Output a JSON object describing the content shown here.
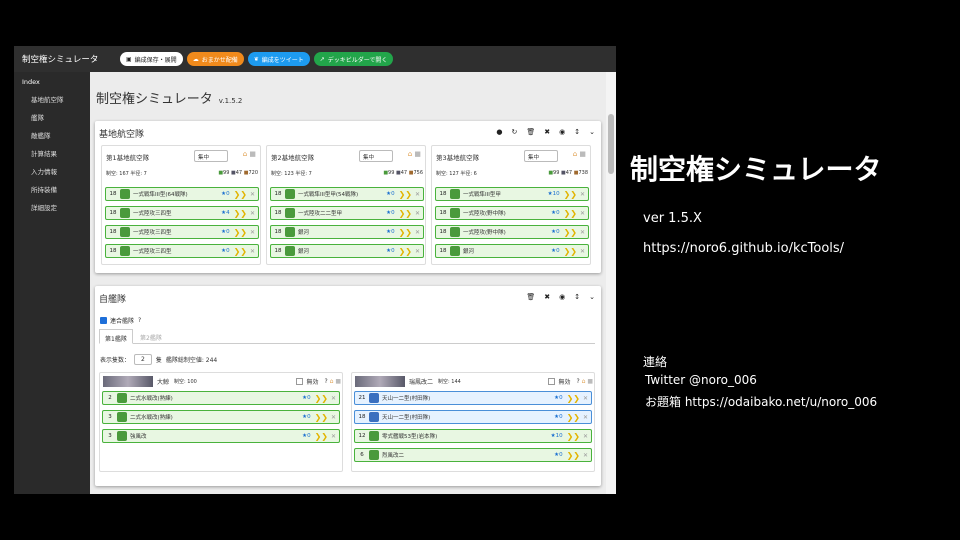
{
  "app": {
    "name": "制空権シミュレータ",
    "title": "制空権シミュレータ",
    "version": "v.1.5.2"
  },
  "toolbar": [
    {
      "label": "編成保存・展開",
      "icon": "save-icon",
      "bg": "#ffffff",
      "fg": "#222222"
    },
    {
      "label": "おまかせ配備",
      "icon": "cloud-icon",
      "bg": "#f08a1c",
      "fg": "#ffffff"
    },
    {
      "label": "編成をツイート",
      "icon": "twitter-icon",
      "bg": "#1d9bf0",
      "fg": "#ffffff"
    },
    {
      "label": "デッキビルダーで開く",
      "icon": "external-link-icon",
      "bg": "#22a54a",
      "fg": "#ffffff"
    }
  ],
  "sidebar": {
    "heading": "Index",
    "items": [
      "基地航空隊",
      "艦隊",
      "敵艦隊",
      "計算結果",
      "入力情報",
      "所持装備",
      "詳細設定"
    ]
  },
  "base_panel": {
    "title": "基地航空隊",
    "bases": [
      {
        "name": "第1基地航空隊",
        "mode": "集中",
        "stat": "制空: 167 半径: 7",
        "res": [
          "99",
          "47",
          "720"
        ],
        "slots": [
          {
            "lvl": "18",
            "name": "一式戦隼III型(64戦隊)",
            "star": "★0"
          },
          {
            "lvl": "18",
            "name": "一式陸攻三四型",
            "star": "★4"
          },
          {
            "lvl": "18",
            "name": "一式陸攻三四型",
            "star": "★0"
          },
          {
            "lvl": "18",
            "name": "一式陸攻三四型",
            "star": "★0"
          }
        ]
      },
      {
        "name": "第2基地航空隊",
        "mode": "集中",
        "stat": "制空: 123 半径: 7",
        "res": [
          "99",
          "47",
          "756"
        ],
        "slots": [
          {
            "lvl": "18",
            "name": "一式戦隼III型甲(54戦隊)",
            "star": "★0"
          },
          {
            "lvl": "18",
            "name": "一式陸攻二二型甲",
            "star": "★0"
          },
          {
            "lvl": "18",
            "name": "銀河",
            "star": "★0"
          },
          {
            "lvl": "18",
            "name": "銀河",
            "star": "★0"
          }
        ]
      },
      {
        "name": "第3基地航空隊",
        "mode": "集中",
        "stat": "制空: 127 半径: 6",
        "res": [
          "99",
          "47",
          "738"
        ],
        "slots": [
          {
            "lvl": "18",
            "name": "一式戦隼III型甲",
            "star": "★10"
          },
          {
            "lvl": "18",
            "name": "一式陸攻(野中隊)",
            "star": "★0"
          },
          {
            "lvl": "18",
            "name": "一式陸攻(野中隊)",
            "star": "★0"
          },
          {
            "lvl": "18",
            "name": "銀河",
            "star": "★0"
          }
        ]
      }
    ]
  },
  "fleet_panel": {
    "title": "自艦隊",
    "combined": "連合艦隊",
    "help": "?",
    "tabs": [
      "第1艦隊",
      "第2艦隊"
    ],
    "display_label": "表示隻数：",
    "display_value": "2",
    "display_unit": "隻",
    "total": "艦隊総制空値: 244",
    "ships": [
      {
        "name": "大鯨",
        "air": "制空: 100",
        "invalid": "無効",
        "slots": [
          {
            "lvl": "2",
            "name": "二式水戦改(熟練)",
            "star": "★0",
            "c": "g"
          },
          {
            "lvl": "3",
            "name": "二式水戦改(熟練)",
            "star": "★0",
            "c": "g"
          },
          {
            "lvl": "3",
            "name": "強風改",
            "star": "★0",
            "c": "g"
          }
        ]
      },
      {
        "name": "瑞鳳改二",
        "air": "制空: 144",
        "invalid": "無効",
        "slots": [
          {
            "lvl": "21",
            "name": "天山一二型(村田隊)",
            "star": "★0",
            "c": "b"
          },
          {
            "lvl": "18",
            "name": "天山一二型(村田隊)",
            "star": "★0",
            "c": "b"
          },
          {
            "lvl": "12",
            "name": "零式艦戦53型(岩本隊)",
            "star": "★10",
            "c": "g"
          },
          {
            "lvl": "6",
            "name": "烈風改二",
            "star": "★0",
            "c": "g"
          }
        ]
      }
    ]
  },
  "info": {
    "title": "制空権シミュレータ",
    "version": "ver 1.5.X",
    "url": "https://noro6.github.io/kcTools/",
    "contact_heading": "連絡",
    "twitter": "Twitter @noro_006",
    "odaibako": "お題箱 https://odaibako.net/u/noro_006"
  }
}
